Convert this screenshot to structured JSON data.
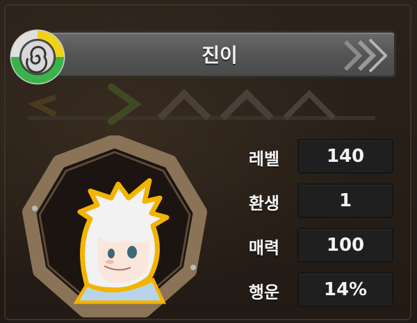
{
  "character": {
    "name": "진이"
  },
  "stats": [
    {
      "label": "레벨",
      "value": "140"
    },
    {
      "label": "환생",
      "value": "1"
    },
    {
      "label": "매력",
      "value": "100"
    },
    {
      "label": "행운",
      "value": "14%"
    }
  ],
  "colors": {
    "background": "#241c16",
    "banner": "#5b5b5b",
    "stat_box": "#1f1f1f",
    "portrait_frame": "#8a7356",
    "portrait_outline": "#f2b400",
    "badge_green": "#3bb34a",
    "badge_yellow": "#f0d21a"
  },
  "icons": {
    "badge": "spiral-rank-badge-icon",
    "banner_arrow": "double-chevron-right-icon",
    "portrait_frame": "nonagon-frame"
  }
}
